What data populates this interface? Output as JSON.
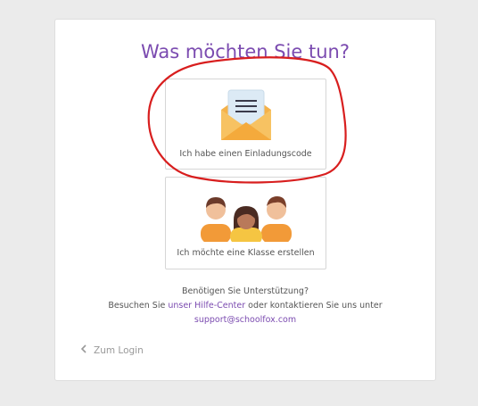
{
  "page": {
    "title": "Was möchten Sie tun?"
  },
  "options": [
    {
      "label": "Ich habe einen Einladungscode",
      "icon": "envelope-icon"
    },
    {
      "label": "Ich möchte eine Klasse erstellen",
      "icon": "people-group-icon"
    }
  ],
  "support": {
    "question": "Benötigen Sie Unterstützung?",
    "line_prefix": "Besuchen Sie",
    "help_center_link": "unser Hilfe-Center",
    "line_suffix": "oder kontaktieren Sie uns unter",
    "email": "support@schoolfox.com"
  },
  "back": {
    "label": "Zum Login",
    "icon": "chevron-left-icon"
  },
  "colors": {
    "accent": "#7b4bb0",
    "annotation": "#d81e1e",
    "background": "#ebebeb"
  }
}
